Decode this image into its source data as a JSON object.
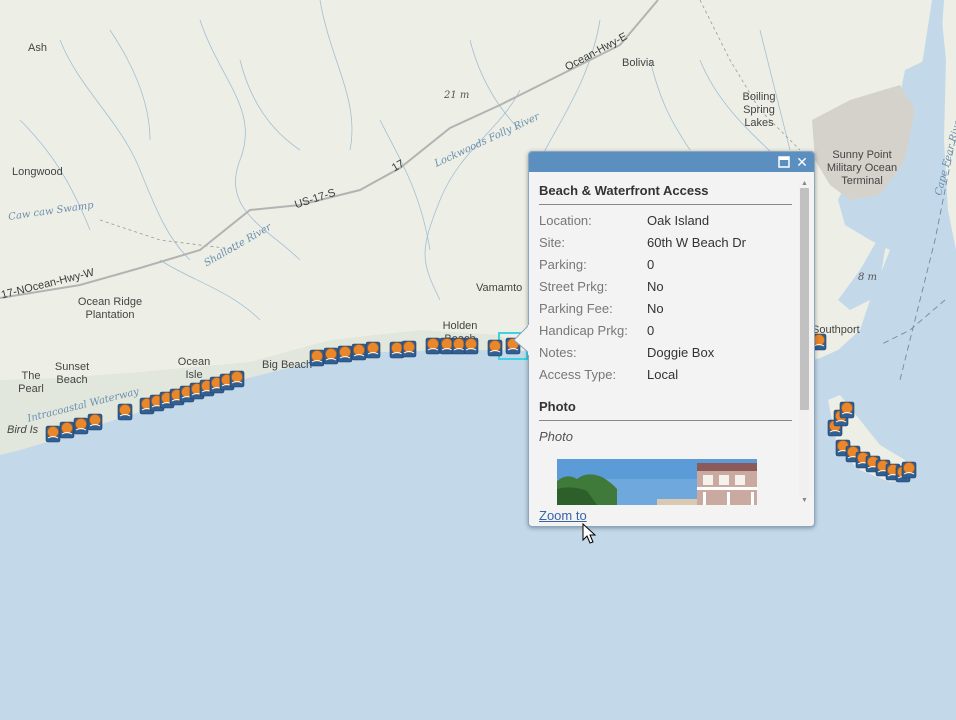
{
  "map": {
    "colors": {
      "land": "#edefe6",
      "ocean": "#c3d9ea",
      "highway": "#b3b3b3",
      "symbol_orange": "#e8872b",
      "symbol_blue": "#2f5f93",
      "selection": "#3ed2e2"
    },
    "places": [
      "Ash",
      "Bolivia",
      "Boiling Spring Lakes",
      "Longwood",
      "Sunny Point Military Ocean Terminal",
      "Ocean Ridge Plantation",
      "Vamamto",
      "Holden Beach",
      "Sunset Beach",
      "Ocean Isle",
      "Big Beach",
      "The Pearl",
      "Bird Is",
      "Southport"
    ],
    "roads": [
      "Ocean-Hwy-E",
      "US-17-S",
      "17",
      "17-NOcean-Hwy-W"
    ],
    "water_labels": [
      "Lockwoods Folly River",
      "Caw caw Swamp",
      "Shallotte River",
      "Intracoastal Waterway",
      "Cape Fear River"
    ],
    "elevations": [
      "21 m",
      "8 m"
    ],
    "layer_icon": "beach-access-icon"
  },
  "popup": {
    "title": "Beach & Waterfront Access",
    "fields": [
      {
        "label": "Location:",
        "value": "Oak Island"
      },
      {
        "label": "Site:",
        "value": "60th W Beach Dr"
      },
      {
        "label": "Parking:",
        "value": "0"
      },
      {
        "label": "Street Prkg:",
        "value": "No"
      },
      {
        "label": "Parking Fee:",
        "value": "No"
      },
      {
        "label": "Handicap Prkg:",
        "value": "0"
      },
      {
        "label": "Notes:",
        "value": "Doggie Box"
      },
      {
        "label": "Access Type:",
        "value": "Local"
      }
    ],
    "photo_heading": "Photo",
    "photo_caption": "Photo",
    "zoom_link": "Zoom to",
    "maximize_icon": "maximize-icon",
    "close_icon": "close-icon"
  }
}
